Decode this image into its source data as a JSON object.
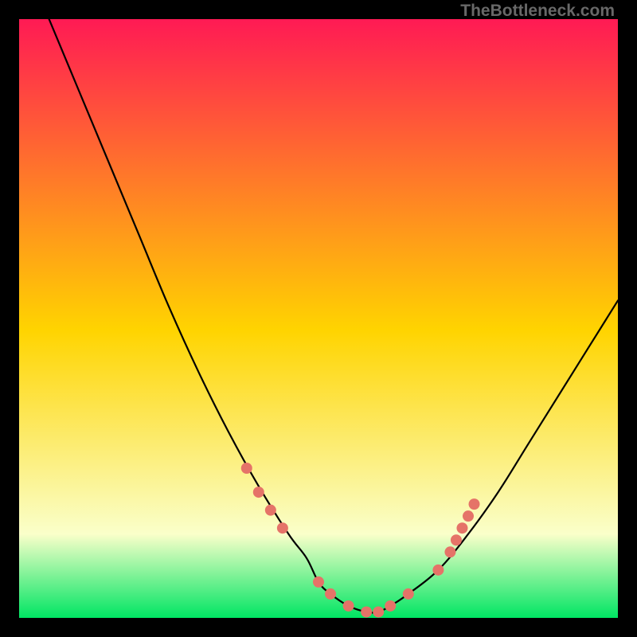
{
  "watermark": "TheBottleneck.com",
  "colors": {
    "top": "#ff1a54",
    "mid": "#ffd400",
    "bottom": "#00e563",
    "haze": "#faffca",
    "curve": "#000000",
    "marker": "#e57368",
    "bg": "#000000"
  },
  "chart_data": {
    "type": "line",
    "title": "",
    "xlabel": "",
    "ylabel": "",
    "xlim": [
      0,
      100
    ],
    "ylim": [
      0,
      100
    ],
    "series": [
      {
        "name": "bottleneck-curve",
        "x": [
          5,
          10,
          15,
          20,
          25,
          30,
          35,
          40,
          45,
          48,
          50,
          52,
          55,
          58,
          60,
          62,
          65,
          70,
          75,
          80,
          85,
          90,
          95,
          100
        ],
        "values": [
          100,
          88,
          76,
          64,
          52,
          41,
          31,
          22,
          14,
          10,
          6,
          4,
          2,
          1,
          1,
          2,
          4,
          8,
          14,
          21,
          29,
          37,
          45,
          53
        ]
      }
    ],
    "markers": {
      "name": "highlighted-points",
      "x": [
        38,
        40,
        42,
        44,
        50,
        52,
        55,
        58,
        60,
        62,
        65,
        70,
        72,
        73,
        74,
        75,
        76
      ],
      "values": [
        25,
        21,
        18,
        15,
        6,
        4,
        2,
        1,
        1,
        2,
        4,
        8,
        11,
        13,
        15,
        17,
        19
      ]
    }
  }
}
